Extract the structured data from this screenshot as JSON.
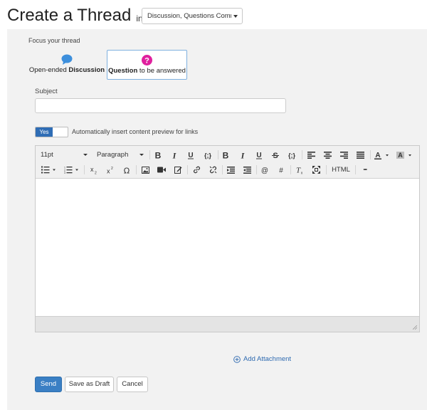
{
  "header": {
    "title": "Create a Thread",
    "in_word": "in",
    "place_selector": "Discussion, Questions Comm"
  },
  "focus": {
    "label": "Focus your thread",
    "options": [
      {
        "prefix": "Open-ended ",
        "bold": "Discussion",
        "suffix": "",
        "icon": "speech-bubble-icon",
        "selected": false
      },
      {
        "prefix": "",
        "bold": "Question",
        "suffix": " to be answered",
        "icon": "question-mark-icon",
        "selected": true
      }
    ]
  },
  "subject": {
    "label": "Subject",
    "value": "",
    "placeholder": ""
  },
  "content_preview": {
    "toggle_label": "Yes",
    "enabled": true,
    "description": "Automatically insert content preview for links"
  },
  "editor": {
    "font_size": "11pt",
    "block_format": "Paragraph",
    "html_label": "HTML",
    "more_label": "•••",
    "toolbar_icons": [
      "bold-icon",
      "italic-icon",
      "underline-icon",
      "code-icon",
      "bold-icon",
      "italic-icon",
      "underline-icon",
      "strikethrough-icon",
      "code-icon",
      "align-left-icon",
      "align-center-icon",
      "align-right-icon",
      "justify-icon",
      "text-color-icon",
      "background-color-icon",
      "bullet-list-icon",
      "numbered-list-icon",
      "subscript-icon",
      "superscript-icon",
      "special-character-icon",
      "image-icon",
      "video-icon",
      "edit-embed-icon",
      "link-icon",
      "unlink-icon",
      "indent-icon",
      "outdent-icon",
      "mention-icon",
      "hashtag-icon",
      "clear-formatting-icon",
      "fullscreen-icon"
    ],
    "body": ""
  },
  "attachment": {
    "label": "Add Attachment"
  },
  "actions": {
    "send": "Send",
    "save_draft": "Save as Draft",
    "cancel": "Cancel"
  },
  "colors": {
    "primary": "#3a7fc4",
    "toggle_on": "#2f6db5",
    "discussion_icon": "#3d8fdc",
    "question_icon": "#e0209e",
    "link": "#2e6ab0",
    "panel_bg": "#f2f2f2"
  }
}
